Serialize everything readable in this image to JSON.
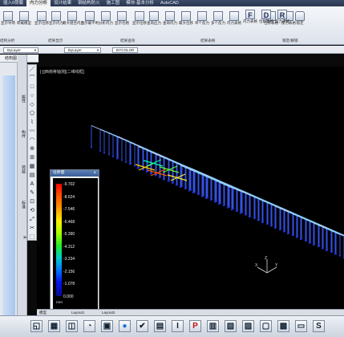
{
  "menu": [
    {
      "label": "插入0荷载",
      "active": false
    },
    {
      "label": "内力分析",
      "active": true
    },
    {
      "label": "设计结果",
      "active": false
    },
    {
      "label": "钢结构防火",
      "active": false
    },
    {
      "label": "施工图",
      "active": false
    },
    {
      "label": "模块-基本分析",
      "active": false
    },
    {
      "label": "AutoCAD",
      "active": false
    }
  ],
  "ribbon": {
    "buttons": [
      {
        "label": "显示导荷",
        "icon": "load-icon"
      },
      {
        "label": "荷载模型",
        "icon": "model-icon"
      },
      {
        "label": "显示位移",
        "icon": "displacement-icon"
      },
      {
        "label": "显示内力",
        "icon": "force-icon"
      },
      {
        "label": "最大组合内力",
        "icon": "combo-icon"
      },
      {
        "label": "显示最不利",
        "icon": "worst-icon"
      },
      {
        "label": "分析内力",
        "icon": "analysis-icon"
      },
      {
        "label": "显示包络",
        "icon": "envelope-icon"
      },
      {
        "label": "显示位移",
        "icon": "shift-icon"
      },
      {
        "label": "查询应力",
        "icon": "stress-icon"
      },
      {
        "label": "查询内力",
        "icon": "query-force-icon"
      },
      {
        "label": "最大位移",
        "icon": "max-disp-icon"
      },
      {
        "label": "单个反力",
        "icon": "reaction-icon"
      },
      {
        "label": "多个反力",
        "icon": "reactions-icon"
      },
      {
        "label": "内力表格",
        "icon": "table-icon"
      },
      {
        "label": "位移表格",
        "icon": "disp-table-icon"
      },
      {
        "label": "反力表格",
        "icon": "reaction-table-icon"
      },
      {
        "label": "锁定",
        "icon": "lock-icon"
      }
    ],
    "letters": [
      "F",
      "D",
      "R"
    ],
    "groups": [
      "结构分析",
      "结果显示",
      "结果查询",
      "结果表格",
      "锁定/解锁"
    ]
  },
  "layer": {
    "combo1": "ByLayer",
    "combo2": "ByLayer",
    "combo3": "BYCOLOR"
  },
  "tree_title": "结构图",
  "side_tabs": [
    "属性",
    "构件",
    "荷载",
    "标准",
    "A"
  ],
  "view_title": "[-][西南等轴测][二维线框]",
  "legend": {
    "title": "位移图",
    "unit": "mm",
    "ticks": [
      "-9.702",
      "-8.624",
      "-7.546",
      "-6.468",
      "-5.390",
      "-4.312",
      "-3.234",
      "-2.156",
      "-1.078",
      "0.000"
    ],
    "colors": [
      "#ff0000",
      "#ff6600",
      "#ffaa00",
      "#ffee00",
      "#99ff00",
      "#22ee22",
      "#00cccc",
      "#0077ff",
      "#0011ee",
      "#0a0a90"
    ]
  },
  "tabs": [
    "模型",
    "Layout1",
    "Layout2"
  ],
  "ucs": {
    "x": "X",
    "y": "Y",
    "z": "Z"
  },
  "status_icons": [
    "square-icon",
    "grid-icon",
    "snap-icon",
    "polar-icon",
    "cube-icon",
    "sphere-icon",
    "check-icon",
    "table-icon",
    "text-icon",
    "pdf-icon",
    "columns-icon",
    "image-icon",
    "stack-icon",
    "box-icon",
    "grid2-icon",
    "frame-icon",
    "s-icon"
  ]
}
